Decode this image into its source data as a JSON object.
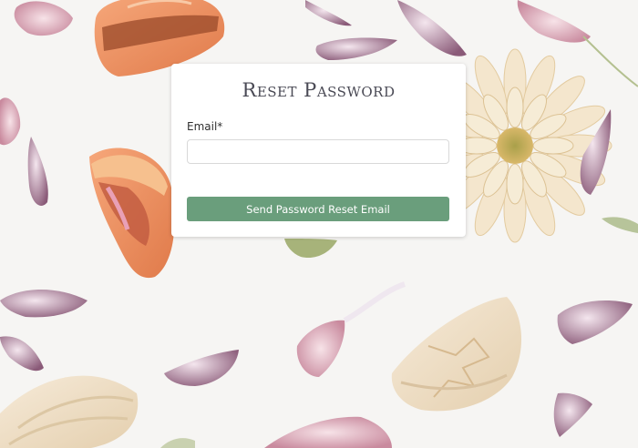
{
  "page": {
    "title": "Reset Password"
  },
  "form": {
    "email_label": "Email*",
    "email_value": "",
    "email_placeholder": "",
    "submit_label": "Send Password Reset Email"
  },
  "colors": {
    "button": "#6a9e7c",
    "title": "#4a4a55",
    "card": "#ffffff",
    "background": "#f3f2ef"
  },
  "background_image": {
    "description_icon": "macarons-flowers-background"
  }
}
